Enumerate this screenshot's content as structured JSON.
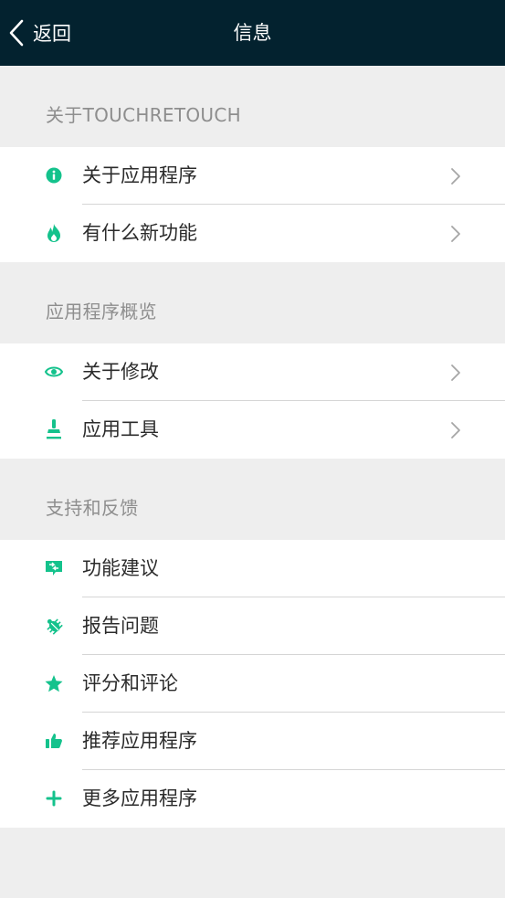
{
  "header": {
    "back_label": "返回",
    "title": "信息"
  },
  "sections": [
    {
      "header": "关于TOUCHRETOUCH",
      "items": [
        {
          "label": "关于应用程序",
          "icon": "info-icon",
          "chevron": true
        },
        {
          "label": "有什么新功能",
          "icon": "flame-icon",
          "chevron": true
        }
      ]
    },
    {
      "header": "应用程序概览",
      "items": [
        {
          "label": "关于修改",
          "icon": "eye-icon",
          "chevron": true
        },
        {
          "label": "应用工具",
          "icon": "stamp-icon",
          "chevron": true
        }
      ]
    },
    {
      "header": "支持和反馈",
      "items": [
        {
          "label": "功能建议",
          "icon": "suggestion-icon",
          "chevron": false
        },
        {
          "label": "报告问题",
          "icon": "bug-icon",
          "chevron": false
        },
        {
          "label": "评分和评论",
          "icon": "star-icon",
          "chevron": false
        },
        {
          "label": "推荐应用程序",
          "icon": "thumbs-up-icon",
          "chevron": false
        },
        {
          "label": "更多应用程序",
          "icon": "plus-icon",
          "chevron": false
        }
      ]
    }
  ],
  "colors": {
    "accent": "#14c28c",
    "topbar": "#03222f",
    "background": "#eeeeee"
  }
}
